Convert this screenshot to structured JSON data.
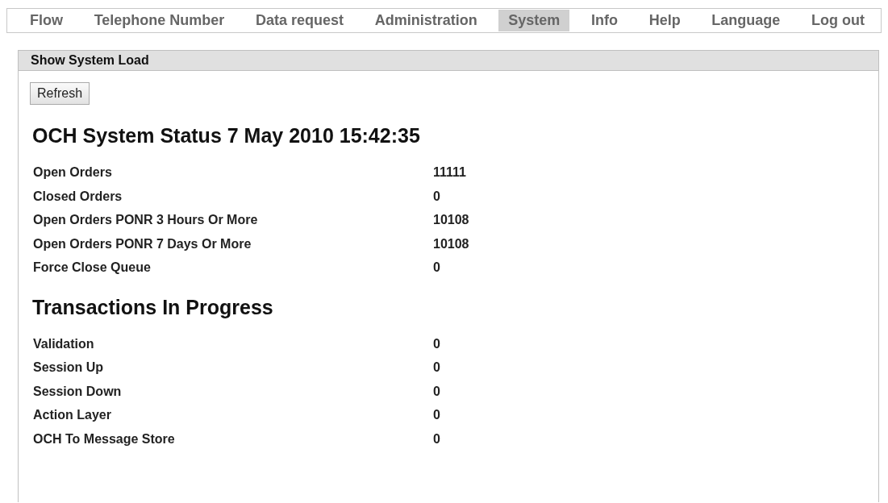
{
  "menu": [
    {
      "label": "Flow",
      "selected": false
    },
    {
      "label": "Telephone Number",
      "selected": false
    },
    {
      "label": "Data request",
      "selected": false
    },
    {
      "label": "Administration",
      "selected": false
    },
    {
      "label": "System",
      "selected": true
    },
    {
      "label": "Info",
      "selected": false
    },
    {
      "label": "Help",
      "selected": false
    },
    {
      "label": "Language",
      "selected": false
    },
    {
      "label": "Log out",
      "selected": false
    }
  ],
  "panel": {
    "title": "Show System Load",
    "button": "Refresh",
    "sections": [
      {
        "heading": "OCH System Status 7 May 2010 15:42:35",
        "rows": [
          {
            "label": "Open Orders",
            "value": "11111"
          },
          {
            "label": "Closed Orders",
            "value": "0"
          },
          {
            "label": "Open Orders PONR 3 Hours Or More",
            "value": "10108"
          },
          {
            "label": "Open Orders PONR 7 Days Or More",
            "value": "10108"
          },
          {
            "label": "Force Close Queue",
            "value": "0"
          }
        ]
      },
      {
        "heading": "Transactions In Progress",
        "rows": [
          {
            "label": "Validation",
            "value": "0"
          },
          {
            "label": "Session Up",
            "value": "0"
          },
          {
            "label": "Session Down",
            "value": "0"
          },
          {
            "label": "Action Layer",
            "value": "0"
          },
          {
            "label": "OCH To Message Store",
            "value": "0"
          }
        ]
      }
    ]
  }
}
